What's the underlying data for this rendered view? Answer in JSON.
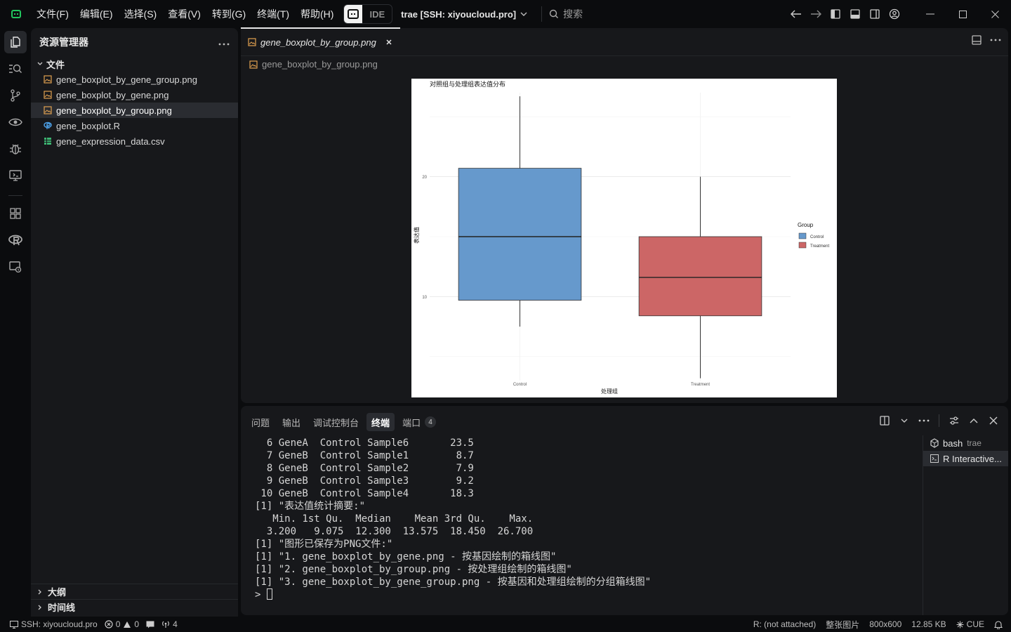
{
  "menubar": {
    "items": [
      "文件(F)",
      "编辑(E)",
      "选择(S)",
      "查看(V)",
      "转到(G)",
      "终端(T)",
      "帮助(H)"
    ],
    "ide_label": "IDE",
    "window_title": "trae [SSH: xiyoucloud.pro]",
    "search_placeholder": "搜索"
  },
  "sidebar": {
    "title": "资源管理器",
    "folder": "文件",
    "files": [
      {
        "name": "gene_boxplot_by_gene_group.png",
        "icon": "image-file-icon"
      },
      {
        "name": "gene_boxplot_by_gene.png",
        "icon": "image-file-icon"
      },
      {
        "name": "gene_boxplot_by_group.png",
        "icon": "image-file-icon"
      },
      {
        "name": "gene_boxplot.R",
        "icon": "r-file-icon"
      },
      {
        "name": "gene_expression_data.csv",
        "icon": "csv-file-icon"
      }
    ],
    "outline_label": "大纲",
    "timeline_label": "时间线"
  },
  "editor": {
    "tab_label": "gene_boxplot_by_group.png",
    "breadcrumb": "gene_boxplot_by_group.png"
  },
  "chart_data": {
    "type": "box",
    "title": "对照组与处理组表达值分布",
    "xlabel": "处理组",
    "ylabel": "表达值",
    "categories": [
      "Control",
      "Treatment"
    ],
    "y_ticks": [
      10,
      20
    ],
    "ylim": [
      3,
      27
    ],
    "legend_title": "Group",
    "legend_position": "right",
    "series": [
      {
        "name": "Control",
        "color": "#6699cc",
        "min": 7.5,
        "q1": 9.7,
        "median": 15.0,
        "q3": 20.7,
        "max": 26.7
      },
      {
        "name": "Treatment",
        "color": "#cc6666",
        "min": 3.2,
        "q1": 8.4,
        "median": 11.6,
        "q3": 15.0,
        "max": 20.0
      }
    ]
  },
  "panel": {
    "tabs": [
      "问题",
      "输出",
      "调试控制台",
      "终端",
      "端口"
    ],
    "ports_count": "4",
    "terminal_lines": [
      "  6 GeneA  Control Sample6       23.5",
      "  7 GeneB  Control Sample1        8.7",
      "  8 GeneB  Control Sample2        7.9",
      "  9 GeneB  Control Sample3        9.2",
      " 10 GeneB  Control Sample4       18.3",
      "[1] \"表达值统计摘要:\"",
      "   Min. 1st Qu.  Median    Mean 3rd Qu.    Max.",
      "  3.200   9.075  12.300  13.575  18.450  26.700",
      "[1] \"图形已保存为PNG文件:\"",
      "[1] \"1. gene_boxplot_by_gene.png - 按基因绘制的箱线图\"",
      "[1] \"2. gene_boxplot_by_group.png - 按处理组绘制的箱线图\"",
      "[1] \"3. gene_boxplot_by_gene_group.png - 按基因和处理组绘制的分组箱线图\""
    ],
    "prompt": "> ",
    "terminals": [
      {
        "name": "bash",
        "sub": "trae"
      },
      {
        "name": "R Interactive...",
        "sub": ""
      }
    ]
  },
  "statusbar": {
    "remote": "SSH: xiyoucloud.pro",
    "errors": "0",
    "warnings": "0",
    "ports": "4",
    "r_status": "R: (not attached)",
    "view_mode": "整张图片",
    "dimensions": "800x600",
    "file_size": "12.85 KB",
    "cue": "CUE"
  }
}
